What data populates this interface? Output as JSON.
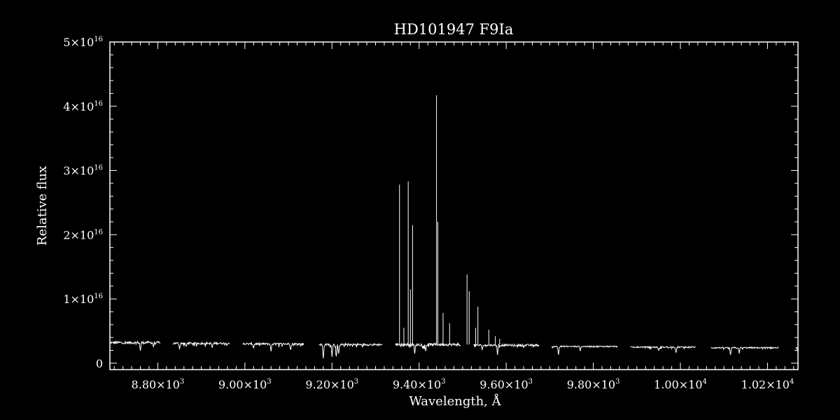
{
  "chart_data": {
    "type": "line",
    "title": "HD101947   F9Ia",
    "xlabel": "Wavelength, Å",
    "ylabel": "Relative flux",
    "xlim": [
      8690,
      10270
    ],
    "ylim": [
      -1000000000000000.0,
      5e+16
    ],
    "x_ticks": [
      {
        "value": 8800,
        "mant": "8.80×10",
        "exp": "3"
      },
      {
        "value": 9000,
        "mant": "9.00×10",
        "exp": "3"
      },
      {
        "value": 9200,
        "mant": "9.20×10",
        "exp": "3"
      },
      {
        "value": 9400,
        "mant": "9.40×10",
        "exp": "3"
      },
      {
        "value": 9600,
        "mant": "9.60×10",
        "exp": "3"
      },
      {
        "value": 9800,
        "mant": "9.80×10",
        "exp": "3"
      },
      {
        "value": 10000,
        "mant": "1.00×10",
        "exp": "4"
      },
      {
        "value": 10200,
        "mant": "1.02×10",
        "exp": "4"
      }
    ],
    "y_ticks": [
      {
        "value": 0,
        "mant": "0",
        "exp": ""
      },
      {
        "value": 1e+16,
        "mant": "1×10",
        "exp": "16"
      },
      {
        "value": 2e+16,
        "mant": "2×10",
        "exp": "16"
      },
      {
        "value": 3e+16,
        "mant": "3×10",
        "exp": "16"
      },
      {
        "value": 4e+16,
        "mant": "4×10",
        "exp": "16"
      },
      {
        "value": 5e+16,
        "mant": "5×10",
        "exp": "16"
      }
    ],
    "segments": [
      {
        "x_start": 8690,
        "x_end": 8805,
        "baseline": 3200000000000000.0,
        "noise": 400000000000000.0,
        "absorptions": [
          [
            8760,
            1200000000000000.0
          ],
          [
            8790,
            600000000000000.0
          ]
        ]
      },
      {
        "x_start": 8835,
        "x_end": 8965,
        "baseline": 3100000000000000.0,
        "noise": 300000000000000.0,
        "absorptions": [
          [
            8850,
            800000000000000.0
          ],
          [
            8865,
            600000000000000.0
          ],
          [
            8925,
            700000000000000.0
          ]
        ]
      },
      {
        "x_start": 8995,
        "x_end": 9135,
        "baseline": 3000000000000000.0,
        "noise": 300000000000000.0,
        "absorptions": [
          [
            9020,
            600000000000000.0
          ],
          [
            9060,
            1200000000000000.0
          ],
          [
            9105,
            800000000000000.0
          ]
        ]
      },
      {
        "x_start": 9170,
        "x_end": 9315,
        "baseline": 2900000000000000.0,
        "noise": 300000000000000.0,
        "absorptions": [
          [
            9180,
            2200000000000000.0
          ],
          [
            9200,
            1800000000000000.0
          ],
          [
            9210,
            1800000000000000.0
          ],
          [
            9215,
            1500000000000000.0
          ]
        ]
      },
      {
        "x_start": 9345,
        "x_end": 9495,
        "baseline": 2900000000000000.0,
        "noise": 400000000000000.0,
        "absorptions": [
          [
            9390,
            1500000000000000.0
          ],
          [
            9415,
            1000000000000000.0
          ]
        ]
      },
      {
        "x_start": 9525,
        "x_end": 9675,
        "baseline": 2800000000000000.0,
        "noise": 300000000000000.0,
        "absorptions": [
          [
            9545,
            600000000000000.0
          ],
          [
            9580,
            1400000000000000.0
          ]
        ]
      },
      {
        "x_start": 9705,
        "x_end": 9855,
        "baseline": 2600000000000000.0,
        "noise": 200000000000000.0,
        "absorptions": [
          [
            9720,
            1200000000000000.0
          ],
          [
            9770,
            600000000000000.0
          ]
        ]
      },
      {
        "x_start": 9885,
        "x_end": 10035,
        "baseline": 2500000000000000.0,
        "noise": 200000000000000.0,
        "absorptions": [
          [
            9950,
            600000000000000.0
          ],
          [
            9990,
            900000000000000.0
          ]
        ]
      },
      {
        "x_start": 10070,
        "x_end": 10225,
        "baseline": 2400000000000000.0,
        "noise": 200000000000000.0,
        "absorptions": [
          [
            10115,
            1200000000000000.0
          ],
          [
            10135,
            800000000000000.0
          ]
        ]
      },
      {
        "x_start": 10265,
        "x_end": 10400,
        "baseline": 2400000000000000.0,
        "noise": 200000000000000.0,
        "absorptions": [
          [
            10270,
            800000000000000.0
          ]
        ]
      }
    ],
    "emission_lines": [
      {
        "x": 9355,
        "peak": 2.78e+16
      },
      {
        "x": 9365,
        "peak": 5500000000000000.0
      },
      {
        "x": 9375,
        "peak": 2.83e+16
      },
      {
        "x": 9380,
        "peak": 1.15e+16
      },
      {
        "x": 9385,
        "peak": 2.15e+16
      },
      {
        "x": 9440,
        "peak": 4.17e+16
      },
      {
        "x": 9443,
        "peak": 2.2e+16
      },
      {
        "x": 9455,
        "peak": 7800000000000000.0
      },
      {
        "x": 9470,
        "peak": 6200000000000000.0
      },
      {
        "x": 9510,
        "peak": 1.38e+16
      },
      {
        "x": 9515,
        "peak": 1.12e+16
      },
      {
        "x": 9530,
        "peak": 5500000000000000.0
      },
      {
        "x": 9535,
        "peak": 8800000000000000.0
      },
      {
        "x": 9560,
        "peak": 5200000000000000.0
      },
      {
        "x": 9575,
        "peak": 4200000000000000.0
      },
      {
        "x": 9585,
        "peak": 3800000000000000.0
      }
    ]
  }
}
